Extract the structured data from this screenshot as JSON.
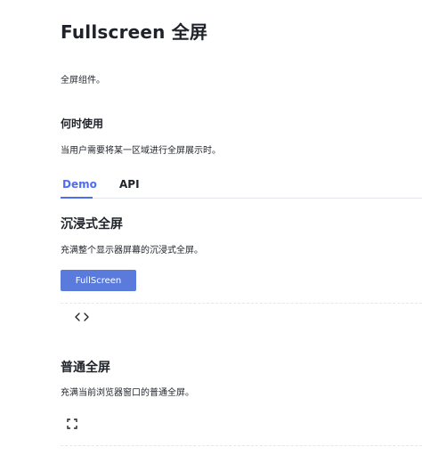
{
  "page": {
    "title": "Fullscreen 全屏",
    "description": "全屏组件。",
    "when_heading": "何时使用",
    "when_text": "当用户需要将某一区域进行全屏展示时。"
  },
  "tabs": [
    {
      "label": "Demo",
      "active": true
    },
    {
      "label": "API",
      "active": false
    }
  ],
  "sections": [
    {
      "title": "沉浸式全屏",
      "description": "充满整个显示器屏幕的沉浸式全屏。",
      "button_label": "FullScreen",
      "code_toggle_icon": "code-icon"
    },
    {
      "title": "普通全屏",
      "description": "充满当前浏览器窗口的普通全屏。",
      "action_icon": "fullscreen-icon"
    }
  ],
  "colors": {
    "accent": "#4e6ef2",
    "button": "#5b7bdc",
    "text": "#1f2329",
    "divider": "#e4e7eb"
  }
}
